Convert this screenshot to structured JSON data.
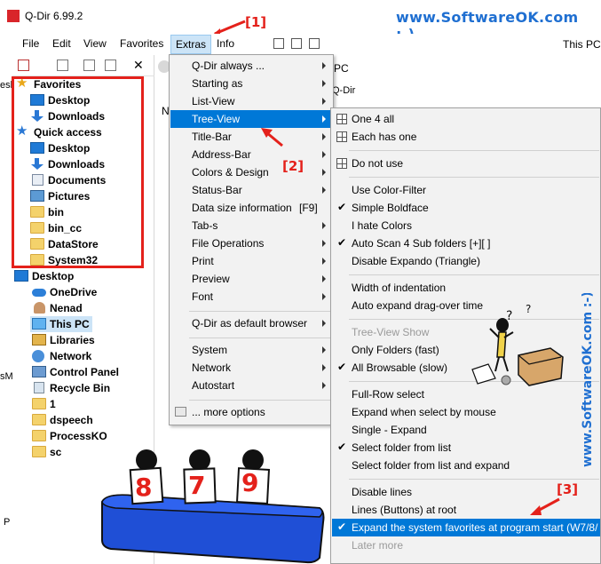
{
  "window": {
    "title": "Q-Dir 6.99.2"
  },
  "watermark": {
    "top": "www.SoftwareOK.com :-)",
    "side": "www.SoftwareOK.com :-)"
  },
  "annotations": {
    "a1": "[1]",
    "a2": "[2]",
    "a3": "[3]"
  },
  "menubar": {
    "items": [
      "File",
      "Edit",
      "View",
      "Favorites",
      "Extras",
      "Info"
    ],
    "right_label": "This PC"
  },
  "tree": {
    "favorites_label": "Favorites",
    "favorites": [
      "Desktop",
      "Downloads"
    ],
    "quick_access_label": "Quick access",
    "quick_access": [
      "Desktop",
      "Downloads",
      "Documents",
      "Pictures",
      "bin",
      "bin_cc",
      "DataStore",
      "System32"
    ],
    "rest": [
      "Desktop",
      "OneDrive",
      "Nenad",
      "This PC",
      "Libraries",
      "Network",
      "Control Panel",
      "Recycle Bin",
      "1",
      "dspeech",
      "ProcessKO",
      "sc"
    ]
  },
  "background_fragments": {
    "pc": "PC",
    "qdir": "Q-Dir",
    "n": "N",
    "esk": "esk",
    "sm": "sM",
    "p": "P"
  },
  "extras_menu": [
    {
      "label": "Q-Dir always ..."
    },
    {
      "label": "Starting as"
    },
    {
      "label": "List-View"
    },
    {
      "label": "Tree-View"
    },
    {
      "label": "Title-Bar"
    },
    {
      "label": "Address-Bar"
    },
    {
      "label": "Colors & Design"
    },
    {
      "label": "Status-Bar"
    },
    {
      "label": "Data size information",
      "shortcut": "[F9]"
    },
    {
      "label": "Tab-s"
    },
    {
      "label": "File Operations"
    },
    {
      "label": "Print"
    },
    {
      "label": "Preview"
    },
    {
      "label": "Font"
    },
    {
      "label": "Q-Dir as default browser"
    },
    {
      "label": "System"
    },
    {
      "label": "Network"
    },
    {
      "label": "Autostart"
    },
    {
      "label": "... more options"
    }
  ],
  "tree_view_menu": [
    {
      "label": "One 4 all"
    },
    {
      "label": "Each has one"
    },
    {
      "label": "Do not use"
    },
    {
      "label": "Use Color-Filter"
    },
    {
      "label": "Simple Boldface"
    },
    {
      "label": "I hate Colors"
    },
    {
      "label": "Auto Scan 4 Sub folders  [+][ ]"
    },
    {
      "label": "Disable Expando (Triangle)"
    },
    {
      "label": "Width of indentation"
    },
    {
      "label": "Auto expand drag-over time"
    },
    {
      "label": "Tree-View Show"
    },
    {
      "label": "Only Folders (fast)"
    },
    {
      "label": "All Browsable (slow)"
    },
    {
      "label": "Full-Row select"
    },
    {
      "label": "Expand when select by mouse"
    },
    {
      "label": "Single - Expand"
    },
    {
      "label": "Select folder from list"
    },
    {
      "label": "Select folder from list and expand"
    },
    {
      "label": "Disable lines"
    },
    {
      "label": "Lines (Buttons) at root"
    },
    {
      "label": "Expand the system favorites at program start (W7/8/"
    },
    {
      "label": "Later more"
    }
  ],
  "check_glyph": "✔",
  "signs": {
    "s1": "8",
    "s2": "7",
    "s3": "9"
  }
}
